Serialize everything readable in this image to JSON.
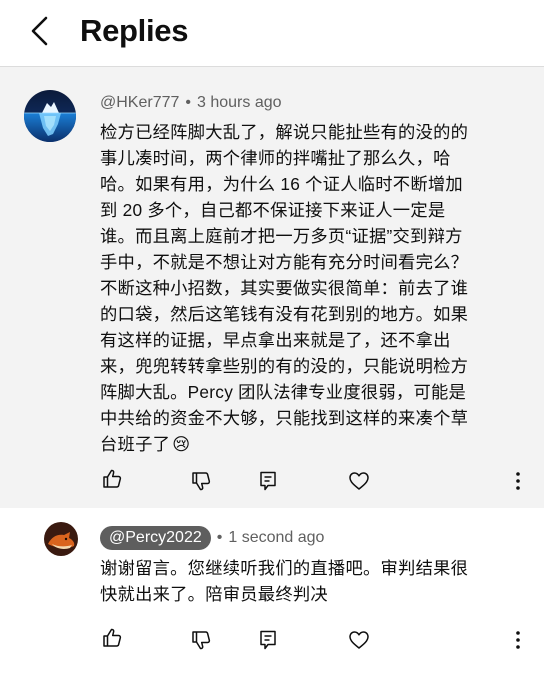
{
  "header": {
    "title": "Replies",
    "back_icon": "chevron-left-icon"
  },
  "thread": {
    "author": "@HKer777",
    "time": "3 hours ago",
    "lines": [
      "检方已经阵脚大乱了，解说只能扯些有的没的的",
      "事儿凑时间，两个律师的拌嘴扯了那么久，哈",
      "哈。如果有用，为什么 16 个证人临时不断增加",
      "到 20 多个，自己都不保证接下来证人一定是",
      "谁。而且离上庭前才把一万多页“证据”交到辩方",
      "手中，不就是不想让对方能有充分时间看完么？",
      "不断这种小招数，其实要做实很简单：前去了谁",
      "的口袋，然后这笔钱有没有花到别的地方。如果",
      "有这样的证据，早点拿出来就是了，还不拿出",
      "来，兜兜转转拿些别的有的没的，只能说明检方",
      "阵脚大乱。Percy 团队法律专业度很弱，可能是",
      "中共给的资金不大够，只能找到这样的来凑个草",
      "台班子了"
    ],
    "emoji": "😢",
    "avatar_icon": "iceberg-avatar"
  },
  "reply": {
    "author": "@Percy2022",
    "time": "1 second ago",
    "lines": [
      "谢谢留言。您继续听我们的直播吧。审判结果很",
      "快就出来了。陪审员最终判决"
    ],
    "avatar_icon": "fox-avatar"
  },
  "actions": [
    "like-icon",
    "dislike-icon",
    "reply-icon",
    "heart-icon",
    "more-vert-icon"
  ],
  "colors": {
    "thread_bg": "#f3f3f3",
    "chip_bg": "#5e5e5e",
    "meta_text": "#606060",
    "icon": "#0f0f0f"
  }
}
